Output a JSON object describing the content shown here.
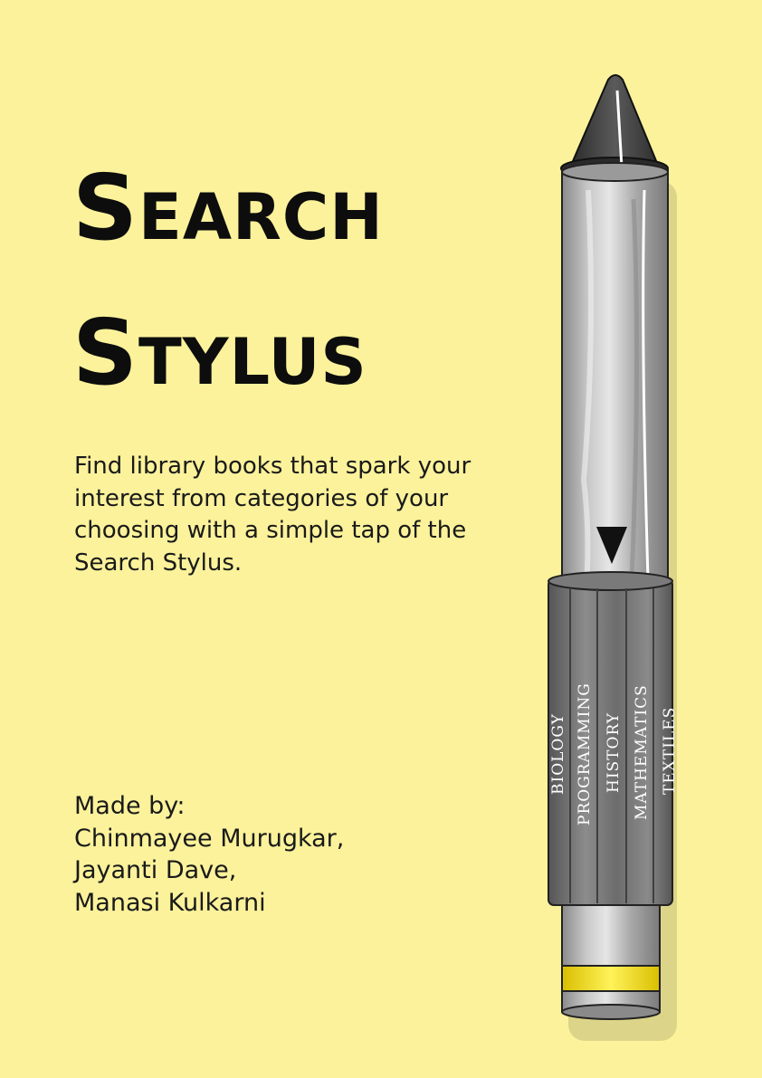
{
  "title": {
    "line1": "Search",
    "line2": "Stylus"
  },
  "description": "Find library books that spark your interest from categories of your choosing with a simple tap of the Search Stylus.",
  "credits": {
    "heading": "Made by:",
    "authors": [
      "Chinmayee Murugkar,",
      "Jayanti Dave,",
      "Manasi Kulkarni"
    ]
  },
  "stylus": {
    "categories": [
      "BIOLOGY",
      "PROGRAMMING",
      "HISTORY",
      "MATHEMATICS",
      "TEXTILES"
    ],
    "colors": {
      "background": "#fbf29b",
      "tip": "#3a3a3a",
      "body": "#b0b0b0",
      "sleeve": "#6f6f6f",
      "band": "#f5d800"
    }
  }
}
